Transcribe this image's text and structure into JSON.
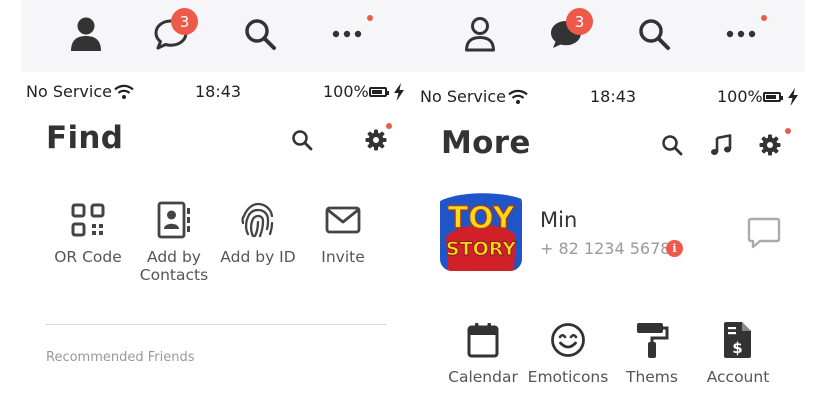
{
  "left": {
    "tabbar": {
      "chat_badge": "3"
    },
    "status": {
      "carrier": "No Service",
      "time": "18:43",
      "battery": "100%"
    },
    "title": "Find",
    "actions": [
      {
        "label": "OR Code",
        "icon": "qr-code-icon"
      },
      {
        "label": "Add by Contacts",
        "icon": "contacts-icon"
      },
      {
        "label": "Add by ID",
        "icon": "fingerprint-icon"
      },
      {
        "label": "Invite",
        "icon": "envelope-icon"
      }
    ],
    "section_label": "Recommended Friends"
  },
  "right": {
    "tabbar": {
      "chat_badge": "3"
    },
    "status": {
      "carrier": "No Service",
      "time": "18:43",
      "battery": "100%"
    },
    "title": "More",
    "profile": {
      "name": "Min",
      "phone": "+ 82 1234 5678",
      "avatar_text_top": "TOY",
      "avatar_text_bottom": "STORY",
      "info_glyph": "i"
    },
    "menu": [
      {
        "label": "Calendar",
        "icon": "calendar-icon"
      },
      {
        "label": "Emoticons",
        "icon": "smiley-icon"
      },
      {
        "label": "Thems",
        "icon": "paint-roller-icon"
      },
      {
        "label": "Account",
        "icon": "invoice-icon"
      }
    ]
  },
  "colors": {
    "accent": "#ee5a4a",
    "icon": "#333333",
    "tabbar_bg": "#f6f6f8",
    "muted": "#999999"
  }
}
